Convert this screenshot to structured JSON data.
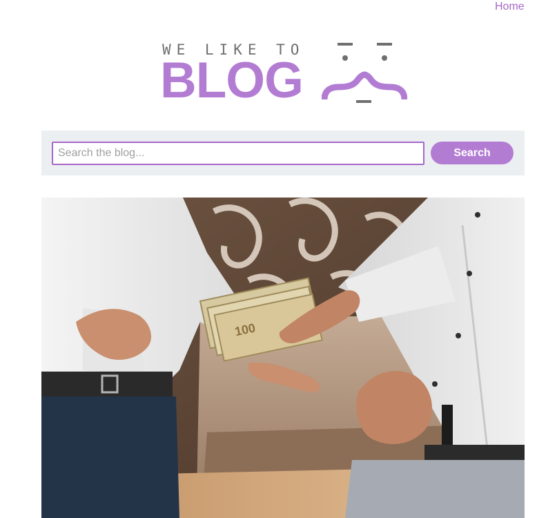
{
  "nav": {
    "home_label": "Home"
  },
  "logo": {
    "tagline": "WE LIKE TO",
    "word": "BLOG",
    "icon": "smiley-face-icon"
  },
  "search": {
    "placeholder": "Search the blog...",
    "value": "",
    "button_label": "Search"
  },
  "hero": {
    "image": "money-handover-photo"
  },
  "colors": {
    "accent": "#b27cd3",
    "link": "#a667c7",
    "search_bg": "#ebeff2"
  }
}
